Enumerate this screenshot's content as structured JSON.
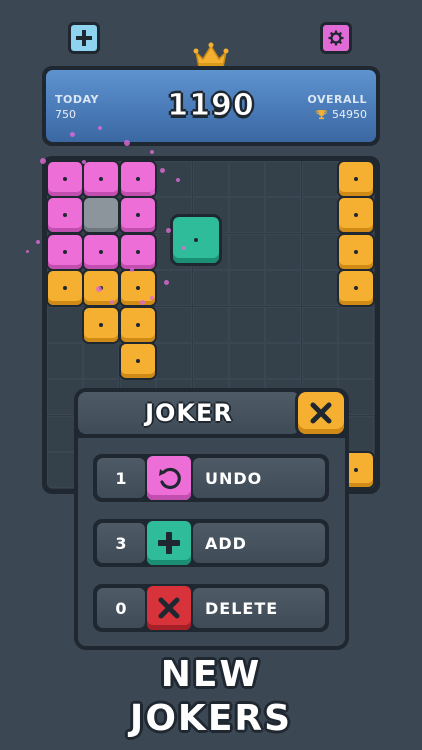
{
  "header": {
    "add_icon": "plus-icon",
    "settings_icon": "gear-icon",
    "crown_icon": "crown-icon",
    "score": "1190",
    "today_label": "TODAY",
    "today_value": "750",
    "overall_label": "OVERALL",
    "overall_value": "54950",
    "trophy_icon": "trophy-icon"
  },
  "colors": {
    "pink": "#ec6ed6",
    "orange": "#f5b032",
    "teal": "#2ebc9a",
    "red": "#d8333b",
    "blue": "#4a7bb8"
  },
  "joker": {
    "title": "JOKER",
    "close_icon": "close-icon",
    "options": [
      {
        "count": "1",
        "icon": "undo-icon",
        "label": "UNDO"
      },
      {
        "count": "3",
        "icon": "plus-icon",
        "label": "ADD"
      },
      {
        "count": "0",
        "icon": "close-icon",
        "label": "DELETE"
      }
    ]
  },
  "promo": {
    "line1": "NEW",
    "line2": "JOKERS"
  }
}
